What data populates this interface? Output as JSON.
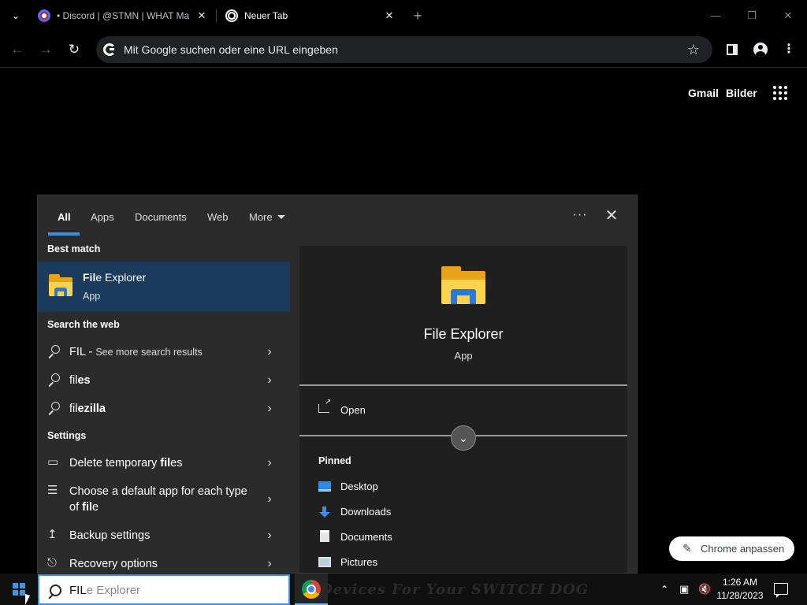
{
  "browser": {
    "tabs": [
      {
        "title": "• Discord | @STMN | WHAT Ma"
      },
      {
        "title": "Neuer Tab"
      }
    ],
    "new_tab_symbol": "+",
    "window_controls": {
      "minimize": "—",
      "restore": "❐",
      "close": "✕"
    },
    "omnibox": {
      "placeholder": "Mit Google suchen oder eine URL eingeben"
    }
  },
  "ntp": {
    "gmail": "Gmail",
    "images": "Bilder",
    "customize": "Chrome anpassen"
  },
  "search": {
    "tabs": [
      "All",
      "Apps",
      "Documents",
      "Web",
      "More"
    ],
    "more_symbol": "···",
    "sections": {
      "best_match": "Best match",
      "search_web": "Search the web",
      "settings": "Settings"
    },
    "best_match": {
      "bold": "Fil",
      "rest": "e Explorer",
      "type": "App"
    },
    "web_results": [
      {
        "bold": "FIL",
        "rest": " - ",
        "hint": "See more search results"
      },
      {
        "bold": "fil",
        "rest": "es",
        "hint": ""
      },
      {
        "bold": "fil",
        "rest": "ezilla",
        "hint": ""
      }
    ],
    "settings_results": [
      {
        "pre": "Delete temporary ",
        "bold": "fil",
        "post": "es"
      },
      {
        "pre": "Choose a default app for each type of ",
        "bold": "fil",
        "post": "e"
      },
      {
        "pre": "Backup settings",
        "bold": "",
        "post": ""
      },
      {
        "pre": "Recovery options",
        "bold": "",
        "post": ""
      }
    ],
    "detail": {
      "title": "File Explorer",
      "type": "App",
      "open": "Open",
      "pinned_head": "Pinned",
      "pinned": [
        "Desktop",
        "Downloads",
        "Documents",
        "Pictures"
      ]
    }
  },
  "taskbar": {
    "typed": "FIL",
    "suggestion": "e Explorer",
    "background_text": "Devices For Your SWITCH DOG",
    "time": "1:26 AM",
    "date": "11/28/2023"
  },
  "colors": {
    "accent": "#3a8ee6",
    "best_match_bg": "#1a3b5b",
    "folder_yellow": "#ffd24d"
  }
}
